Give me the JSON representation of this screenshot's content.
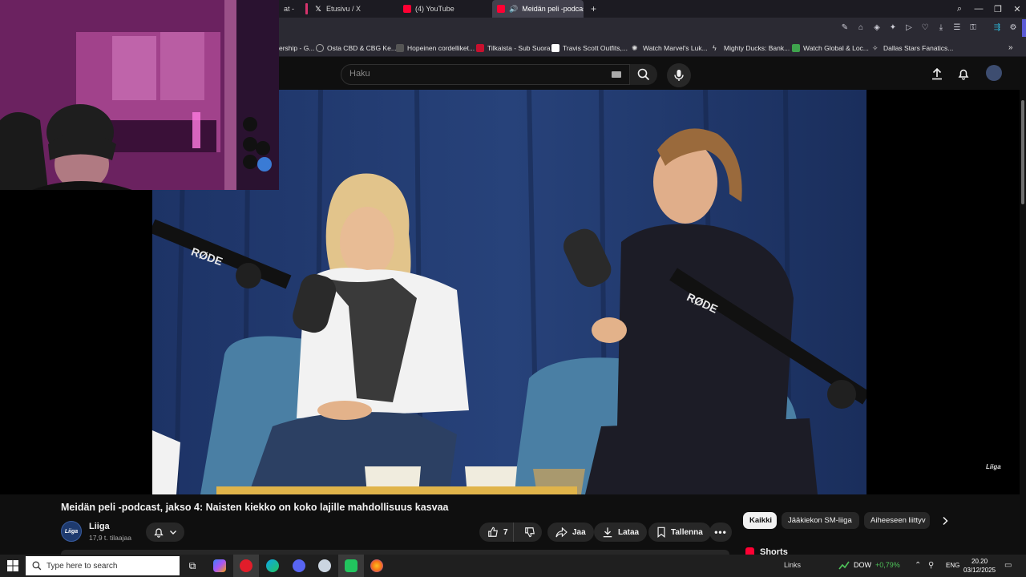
{
  "browser": {
    "tabs": [
      {
        "label": "at - ",
        "icon": "generic-tab-icon"
      },
      {
        "label": "Etusivu / X",
        "icon": "x-logo-icon"
      },
      {
        "label": "(4) YouTube",
        "icon": "youtube-icon"
      },
      {
        "label": "Meidän peli -podcast",
        "icon": "youtube-icon",
        "active": true
      }
    ],
    "new_tab_label": "+",
    "bookmarks": [
      {
        "label": "ership - G..."
      },
      {
        "label": "Osta CBD & CBG Ke..."
      },
      {
        "label": "Hopeinen cordelliket..."
      },
      {
        "label": "Tilkaista - Sub Suora"
      },
      {
        "label": "Travis Scott Outfits,..."
      },
      {
        "label": "Watch Marvel's Luk..."
      },
      {
        "label": "Mighty Ducks: Bank..."
      },
      {
        "label": "Watch Global & Loc..."
      },
      {
        "label": "Dallas Stars Fanatics..."
      }
    ]
  },
  "header": {
    "search_placeholder": "Haku"
  },
  "video": {
    "title": "Meidän peli -podcast, jakso 4: Naisten kiekko on koko lajille mahdollisuus kasvaa",
    "mic_brand": "RØDE",
    "watermark": "Liiga"
  },
  "channel": {
    "name": "Liiga",
    "subscribers": "17,9 t. tilaajaa",
    "avatar_text": "Liiga"
  },
  "actions": {
    "like_count": "7",
    "share_label": "Jaa",
    "download_label": "Lataa",
    "save_label": "Tallenna"
  },
  "chips": [
    {
      "label": "Kaikki",
      "active": true
    },
    {
      "label": "Jääkiekon SM-liiga"
    },
    {
      "label": "Aiheeseen liittyv"
    }
  ],
  "shorts_label": "Shorts",
  "taskbar": {
    "search_placeholder": "Type here to search",
    "links_label": "Links",
    "stock_name": "DOW",
    "stock_change": "+0,79%",
    "language": "ENG",
    "time": "20.20",
    "date": "03/12/2025"
  },
  "colors": {
    "youtube_bg": "#0f0f0f",
    "accent_red": "#ff0033",
    "active_chip": "#f1f1f1",
    "stock_up": "#4fc45a"
  }
}
